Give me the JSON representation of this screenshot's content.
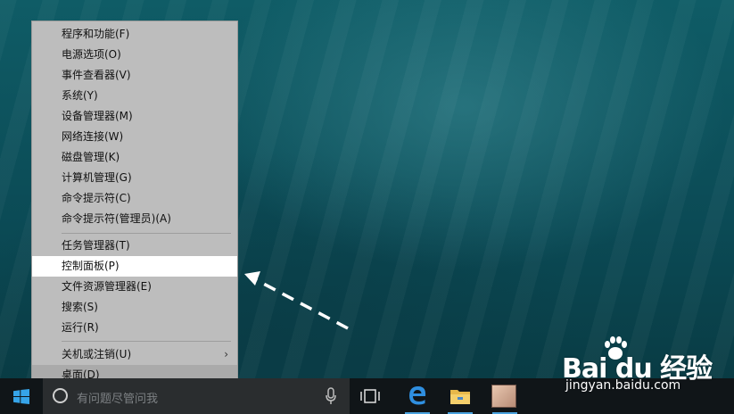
{
  "menu": {
    "items": [
      {
        "label": "程序和功能(F)"
      },
      {
        "label": "电源选项(O)"
      },
      {
        "label": "事件查看器(V)"
      },
      {
        "label": "系统(Y)"
      },
      {
        "label": "设备管理器(M)"
      },
      {
        "label": "网络连接(W)"
      },
      {
        "label": "磁盘管理(K)"
      },
      {
        "label": "计算机管理(G)"
      },
      {
        "label": "命令提示符(C)"
      },
      {
        "label": "命令提示符(管理员)(A)"
      },
      {
        "label": "任务管理器(T)"
      },
      {
        "label": "控制面板(P)"
      },
      {
        "label": "文件资源管理器(E)"
      },
      {
        "label": "搜索(S)"
      },
      {
        "label": "运行(R)"
      },
      {
        "label": "关机或注销(U)"
      },
      {
        "label": "桌面(D)"
      }
    ],
    "highlighted": "控制面板(P)"
  },
  "taskbar": {
    "search_placeholder": "有问题尽管问我",
    "icons": [
      "windows-logo-icon",
      "cortana-ring-icon",
      "microphone-icon",
      "task-view-icon",
      "edge-icon",
      "file-explorer-icon",
      "photo-app-icon"
    ]
  },
  "watermark": {
    "logo": "Bai du 经验",
    "url": "jingyan.baidu.com"
  },
  "colors": {
    "menu_bg": "#bdbdbd",
    "highlight_bg": "#ffffff",
    "taskbar_bg": "#101518",
    "accent": "#4aa3df"
  }
}
